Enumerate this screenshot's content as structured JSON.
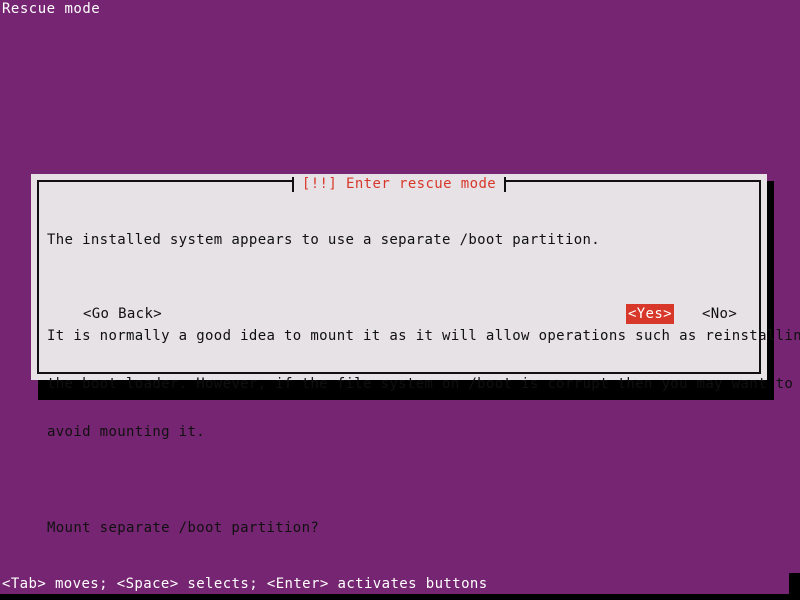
{
  "screen": {
    "mode_label": "Rescue mode",
    "background_color": "#762572",
    "text_color": "#ffffff"
  },
  "dialog": {
    "title": "[!!] Enter rescue mode",
    "title_color": "#d8382a",
    "background_color": "#e6e2e6",
    "border_color": "#101010",
    "paragraphs": [
      "The installed system appears to use a separate /boot partition.",
      "It is normally a good idea to mount it as it will allow operations such as reinstalling\nthe boot loader. However, if the file system on /boot is corrupt then you may want to\navoid mounting it.",
      "Mount separate /boot partition?"
    ],
    "lines": {
      "p1": "The installed system appears to use a separate /boot partition.",
      "p2_l1": "It is normally a good idea to mount it as it will allow operations such as reinstalling",
      "p2_l2": "the boot loader. However, if the file system on /boot is corrupt then you may want to",
      "p2_l3": "avoid mounting it.",
      "p3": "Mount separate /boot partition?"
    },
    "buttons": {
      "go_back": "<Go Back>",
      "yes": "<Yes>",
      "no": "<No>",
      "selected": "<Yes>",
      "highlight_color": "#d8382a",
      "highlight_text_color": "#ffffff"
    }
  },
  "footer": {
    "help_text": "<Tab> moves; <Space> selects; <Enter> activates buttons"
  }
}
